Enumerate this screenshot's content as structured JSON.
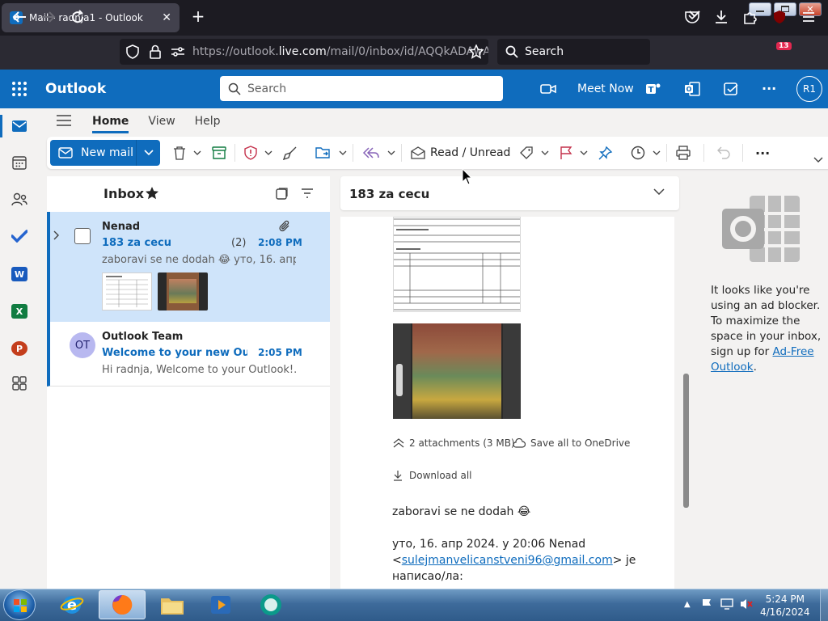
{
  "browser": {
    "tab_title": "Mail - radnja1 - Outlook",
    "tab_favicon": "O",
    "url_prefix": "https://outlook.",
    "url_domain": "live.com",
    "url_path": "/mail/0/inbox/id/AQQkADAwA",
    "search_label": "Search",
    "extensions_badge": "13"
  },
  "outlook": {
    "app_name": "Outlook",
    "search_placeholder": "Search",
    "meet_now": "Meet Now",
    "avatar_initials": "R1",
    "brand_color": "#0f6cbd"
  },
  "ribbon": {
    "tabs": [
      {
        "label": "Home",
        "active": true
      },
      {
        "label": "View",
        "active": false
      },
      {
        "label": "Help",
        "active": false
      }
    ],
    "new_mail": "New mail",
    "read_unread": "Read / Unread"
  },
  "message_list": {
    "folder": "Inbox",
    "messages": [
      {
        "sender": "Nenad",
        "subject": "183 za cecu",
        "count": "(2)",
        "time": "2:08 PM",
        "preview": "zaboravi se ne dodah 😂 уто, 16. апр...",
        "selected": true,
        "has_attachment": true
      },
      {
        "sender": "Outlook Team",
        "initials": "OT",
        "subject": "Welcome to your new Out...",
        "time": "2:05 PM",
        "preview": "Hi radnja, Welcome to your Outlook!...",
        "selected": false
      }
    ]
  },
  "reading_pane": {
    "subject": "183 za cecu",
    "attachments_label": "2 attachments (3 MB)",
    "save_onedrive": "Save all to OneDrive",
    "download_all": "Download all",
    "body_line1": "zaboravi se ne dodah 😂",
    "quote_header": "уто, 16. апр 2024. у 20:06 Nenad",
    "quote_email_open": "<",
    "quote_email": "sulejmanvelicanstveni96@gmail.com",
    "quote_email_close": "> je",
    "quote_tail": "написао/ла:"
  },
  "ad_pane": {
    "text": "It looks like you're using an ad blocker. To maximize the space in your inbox, sign up for",
    "link": "Ad-Free Outlook",
    "after_link": "."
  },
  "taskbar": {
    "time": "5:24 PM",
    "date": "4/16/2024"
  }
}
